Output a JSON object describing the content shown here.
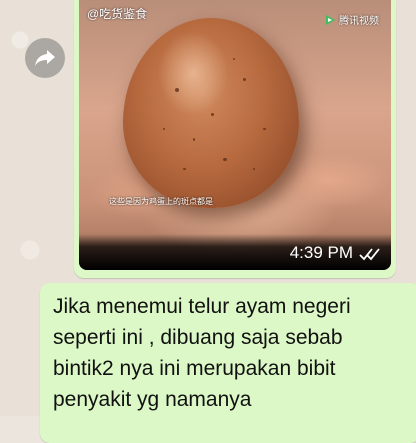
{
  "video": {
    "watermark_left": "@吃货鉴食",
    "watermark_right": "腾讯视频",
    "subtitle": "这些是因为鸡蛋上的斑点都是",
    "timestamp": "4:39 PM",
    "read_status": "read"
  },
  "message": {
    "text": "Jika menemui telur ayam negeri\nseperti ini , dibuang saja sebab\nbintik2 nya ini merupakan bibit\npenyakit yg namanya"
  },
  "colors": {
    "bubble_green": "#dcf8c6",
    "wallpaper": "#e9e1d7",
    "read_ticks": "#ffffff"
  },
  "icons": [
    "forward-icon",
    "tencent-video-logo-icon",
    "double-check-icon"
  ]
}
